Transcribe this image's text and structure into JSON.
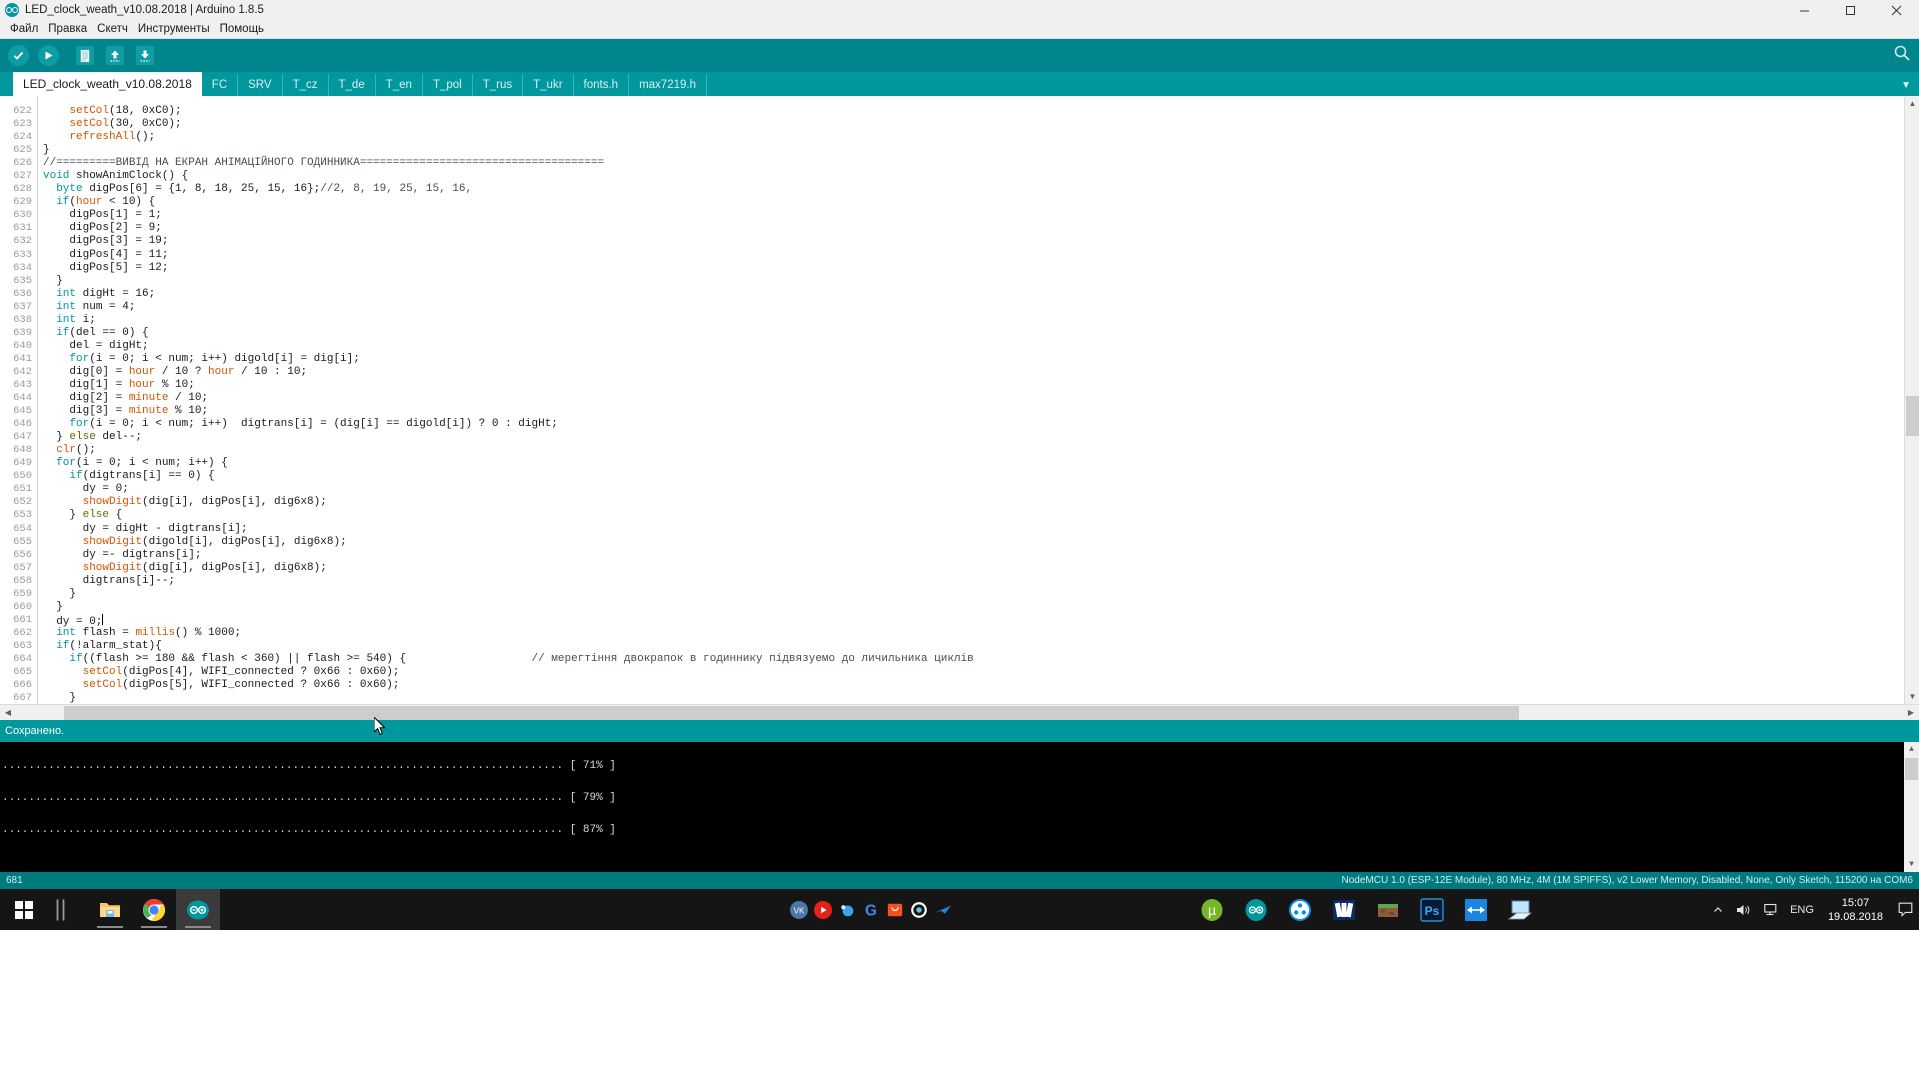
{
  "window": {
    "title": "LED_clock_weath_v10.08.2018 | Arduino 1.8.5",
    "logo_icon": "arduino-logo-icon",
    "minimize_icon": "minimize-icon",
    "maximize_icon": "maximize-icon",
    "close_icon": "close-icon"
  },
  "menubar": {
    "items": [
      {
        "label": "Файл",
        "name": "menu-file"
      },
      {
        "label": "Правка",
        "name": "menu-edit"
      },
      {
        "label": "Скетч",
        "name": "menu-sketch"
      },
      {
        "label": "Инструменты",
        "name": "menu-tools"
      },
      {
        "label": "Помощь",
        "name": "menu-help"
      }
    ]
  },
  "toolbar": {
    "verify_icon": "check-icon",
    "upload_icon": "arrow-right-icon",
    "new_icon": "new-file-icon",
    "open_icon": "arrow-up-icon",
    "save_icon": "arrow-down-icon",
    "serial_monitor_icon": "magnifier-icon",
    "accent_color": "#00858c"
  },
  "tabs": {
    "items": [
      {
        "label": "LED_clock_weath_v10.08.2018",
        "active": true
      },
      {
        "label": "FC",
        "active": false
      },
      {
        "label": "SRV",
        "active": false
      },
      {
        "label": "T_cz",
        "active": false
      },
      {
        "label": "T_de",
        "active": false
      },
      {
        "label": "T_en",
        "active": false
      },
      {
        "label": "T_pol",
        "active": false
      },
      {
        "label": "T_rus",
        "active": false
      },
      {
        "label": "T_ukr",
        "active": false
      },
      {
        "label": "fonts.h",
        "active": false
      },
      {
        "label": "max7219.h",
        "active": false
      }
    ],
    "dropdown_icon": "chevron-down-icon"
  },
  "editor": {
    "first_line_number": 622,
    "lines": [
      "    setCol(18, 0xC0);",
      "    setCol(30, 0xC0);",
      "    refreshAll();",
      "}",
      "//=========ВИВІД НА ЕКРАН АНІМАЦІЙНОГО ГОДИННИКА=====================================",
      "void showAnimClock() {",
      "  byte digPos[6] = {1, 8, 18, 25, 15, 16};//2, 8, 19, 25, 15, 16,",
      "  if(hour < 10) {",
      "    digPos[1] = 1;",
      "    digPos[2] = 9;",
      "    digPos[3] = 19;",
      "    digPos[4] = 11;",
      "    digPos[5] = 12;",
      "  }",
      "  int digHt = 16;",
      "  int num = 4;",
      "  int i;",
      "  if(del == 0) {",
      "    del = digHt;",
      "    for(i = 0; i < num; i++) digold[i] = dig[i];",
      "    dig[0] = hour / 10 ? hour / 10 : 10;",
      "    dig[1] = hour % 10;",
      "    dig[2] = minute / 10;",
      "    dig[3] = minute % 10;",
      "    for(i = 0; i < num; i++)  digtrans[i] = (dig[i] == digold[i]) ? 0 : digHt;",
      "  } else del--;",
      "  clr();",
      "  for(i = 0; i < num; i++) {",
      "    if(digtrans[i] == 0) {",
      "      dy = 0;",
      "      showDigit(dig[i], digPos[i], dig6x8);",
      "    } else {",
      "      dy = digHt - digtrans[i];",
      "      showDigit(digold[i], digPos[i], dig6x8);",
      "      dy =- digtrans[i];",
      "      showDigit(dig[i], digPos[i], dig6x8);",
      "      digtrans[i]--;",
      "    }",
      "  }",
      "  dy = 0;",
      "  int flash = millis() % 1000;",
      "  if(!alarm_stat){",
      "    if((flash >= 180 && flash < 360) || flash >= 540) {                   // мерегтіння двокрапок в годиннику підвязуемо до личильника циклів",
      "      setCol(digPos[4], WIFI_connected ? 0x66 : 0x60);",
      "      setCol(digPos[5], WIFI_connected ? 0x66 : 0x60);",
      "    }"
    ],
    "cursor_line_number": 661,
    "cursor_column": 9
  },
  "status": {
    "message": "Сохранено."
  },
  "console": {
    "lines": [
      "..................................................................................... [ 71% ]",
      "..................................................................................... [ 79% ]",
      "..................................................................................... [ 87% ]"
    ]
  },
  "ide_bottom": {
    "line_number": "681",
    "board_info": "NodeMCU 1.0 (ESP-12E Module), 80 MHz, 4M (1M SPIFFS), v2 Lower Memory, Disabled, None, Only Sketch, 115200 на COM6"
  },
  "taskbar": {
    "start_icon": "windows-start-icon",
    "task_view_icon": "task-view-icon",
    "pinned_left": [
      {
        "name": "file-explorer-icon",
        "label": "File Explorer"
      },
      {
        "name": "chrome-icon",
        "label": "Google Chrome"
      },
      {
        "name": "arduino-ide-icon",
        "label": "Arduino IDE"
      }
    ],
    "tray_apps": [
      {
        "name": "vk-icon",
        "label": "VK"
      },
      {
        "name": "youtube-icon",
        "label": "YouTube"
      },
      {
        "name": "blue-dot-icon",
        "label": "App"
      },
      {
        "name": "google-icon",
        "label": "Google"
      },
      {
        "name": "orange-bag-icon",
        "label": "Shop"
      },
      {
        "name": "gear-icon",
        "label": "Settings"
      },
      {
        "name": "blue-swoosh-icon",
        "label": "App"
      }
    ],
    "pinned_right": [
      {
        "name": "utorrent-icon",
        "label": "uTorrent"
      },
      {
        "name": "arduino-icon",
        "label": "Arduino"
      },
      {
        "name": "teamviewer-icon",
        "label": "TeamViewer"
      },
      {
        "name": "solitaire-icon",
        "label": "Solitaire"
      },
      {
        "name": "minecraft-icon",
        "label": "Minecraft"
      },
      {
        "name": "photoshop-icon",
        "label": "Photoshop"
      },
      {
        "name": "bluestacks-icon",
        "label": "Resize"
      },
      {
        "name": "remote-desktop-icon",
        "label": "Remote Desktop"
      }
    ],
    "systray": {
      "chevron_icon": "chevron-up-icon",
      "volume_icon": "speaker-icon",
      "network_icon": "monitor-icon",
      "language": "ENG",
      "time": "15:07",
      "date": "19.08.2018",
      "action_center_icon": "notification-icon"
    }
  }
}
